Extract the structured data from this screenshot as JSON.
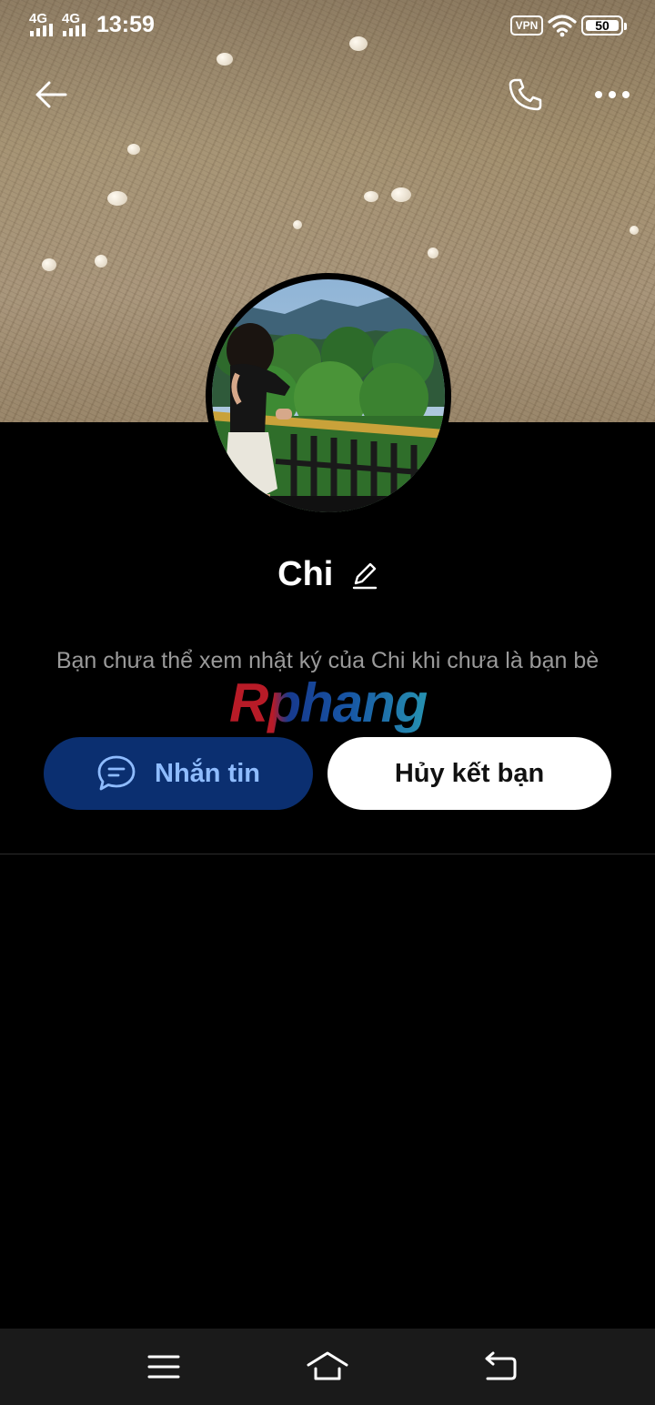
{
  "status_bar": {
    "network_1": "4G",
    "network_2": "4G",
    "time": "13:59",
    "vpn": "VPN",
    "battery": "50"
  },
  "header": {
    "back_icon": "arrow-left-icon",
    "call_icon": "phone-icon",
    "more_icon": "more-horizontal-icon"
  },
  "profile": {
    "name": "Chi",
    "edit_icon": "pencil-icon",
    "notice": "Bạn chưa thể xem nhật ký của Chi khi chưa là bạn bè"
  },
  "watermark": "Rphang",
  "actions": {
    "message_label": "Nhắn tin",
    "unfriend_label": "Hủy kết bạn"
  },
  "system_nav": {
    "menu_icon": "menu-icon",
    "home_icon": "home-icon",
    "back_icon": "back-icon"
  },
  "colors": {
    "background": "#000000",
    "message_button": "#0b2f70",
    "message_text": "#8fbcff",
    "unfriend_button": "#ffffff",
    "notice_text": "#9a9a9a"
  }
}
